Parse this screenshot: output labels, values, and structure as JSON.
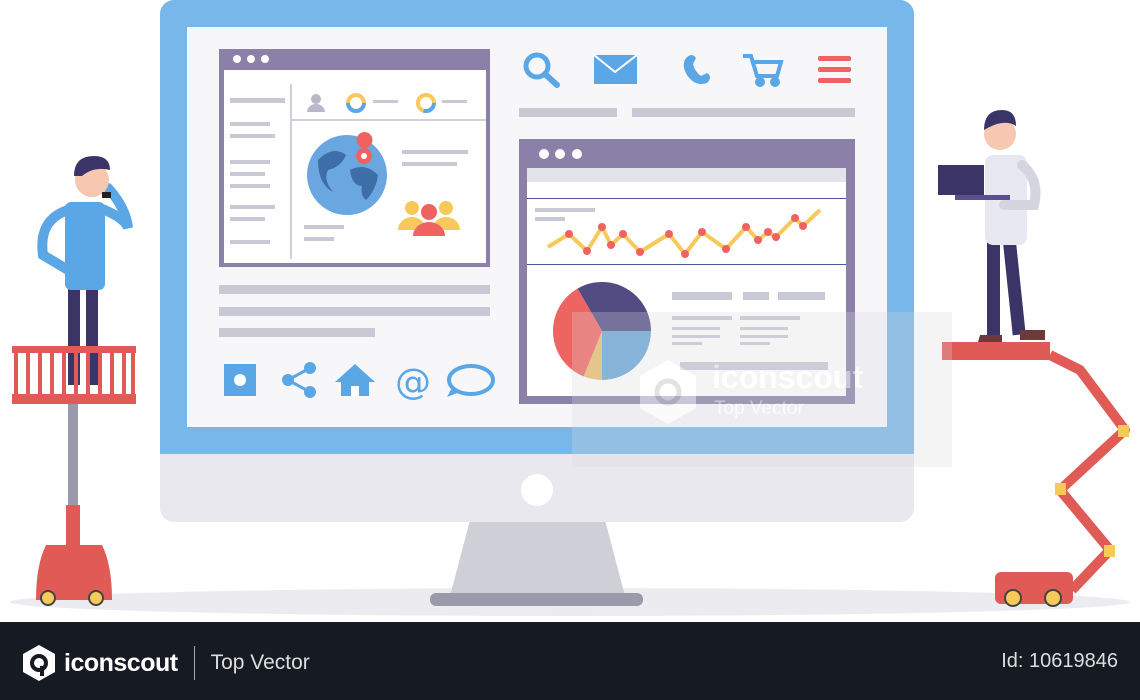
{
  "watermark": {
    "brand": "iconscout",
    "tagline": "Top Vector"
  },
  "footer": {
    "brand": "iconscout",
    "tagline": "Top Vector",
    "asset_id": "Id: 10619846"
  },
  "colors": {
    "monitor": "#78b7e9",
    "frame": "#8a80a8",
    "accent_red": "#f0625f",
    "icon_blue": "#5ba7e6",
    "line_yellow": "#f7c85a",
    "footer_bg": "#161a23"
  },
  "screen_icons_top": [
    "search-icon",
    "mail-icon",
    "phone-icon",
    "cart-icon",
    "menu-icon"
  ],
  "screen_icons_bottom": [
    "image-icon",
    "share-icon",
    "home-icon",
    "at-icon",
    "chat-icon"
  ]
}
